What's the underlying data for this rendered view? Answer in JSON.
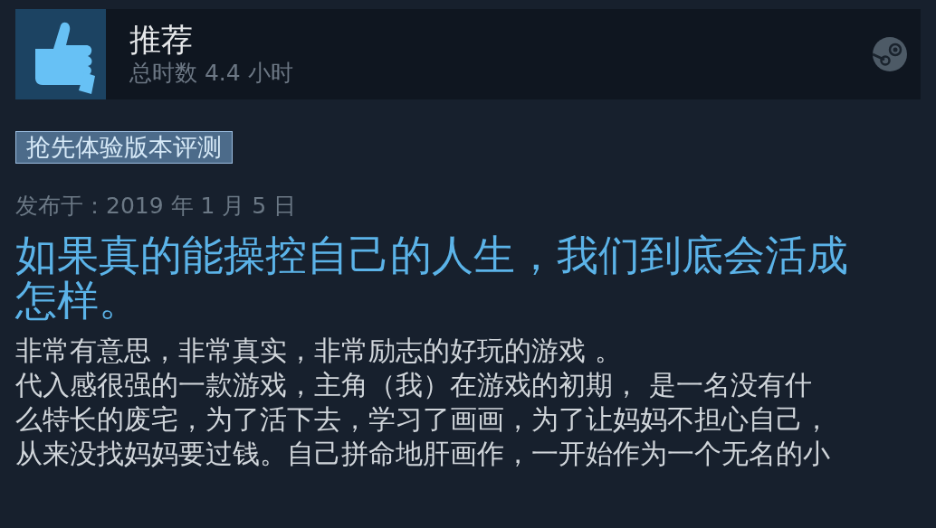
{
  "review_header": {
    "verdict": "推荐",
    "hours": "总时数 4.4 小时",
    "recommended": true
  },
  "badge": "抢先体验版本评测",
  "posted_date": "发布于：2019 年 1 月 5 日",
  "headline": "如果真的能操控自己的人生，我们到底会活成怎样。",
  "body_lines": [
    "非常有意思，非常真实，非常励志的好玩的游戏 。",
    "代入感很强的一款游戏，主角（我）在游戏的初期， 是一名没有什",
    "么特长的废宅，为了活下去，学习了画画，为了让妈妈不担心自己，",
    "从来没找妈妈要过钱。自己拼命地肝画作，一开始作为一个无名的小"
  ]
}
